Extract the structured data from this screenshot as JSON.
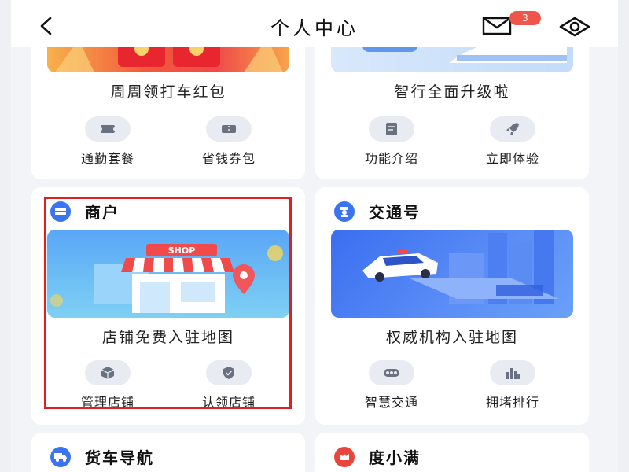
{
  "header": {
    "title": "个人中心",
    "mail_badge": "3"
  },
  "cards": {
    "top_left": {
      "banner_caption": "周周领打车红包",
      "actions": [
        {
          "label": "通勤套餐",
          "icon": "ticket-icon"
        },
        {
          "label": "省钱券包",
          "icon": "coupon-icon"
        }
      ]
    },
    "top_right": {
      "banner_caption": "智行全面升级啦",
      "actions": [
        {
          "label": "功能介绍",
          "icon": "document-icon"
        },
        {
          "label": "立即体验",
          "icon": "rocket-icon"
        }
      ]
    },
    "merchant": {
      "title": "商户",
      "banner_text": "SHOP",
      "banner_caption": "店铺免费入驻地图",
      "actions": [
        {
          "label": "管理店铺",
          "icon": "box-icon"
        },
        {
          "label": "认领店铺",
          "icon": "shield-check-icon"
        }
      ]
    },
    "traffic": {
      "title": "交通号",
      "banner_caption": "权威机构入驻地图",
      "actions": [
        {
          "label": "智慧交通",
          "icon": "traffic-light-icon"
        },
        {
          "label": "拥堵排行",
          "icon": "bar-chart-icon"
        }
      ]
    },
    "truck": {
      "title": "货车导航"
    },
    "duxiaoman": {
      "title": "度小满"
    }
  },
  "colors": {
    "accent_blue": "#3b74f0",
    "badge_red": "#f0554b",
    "highlight_red": "#e02020",
    "duxiaoman_red": "#e8453c"
  }
}
